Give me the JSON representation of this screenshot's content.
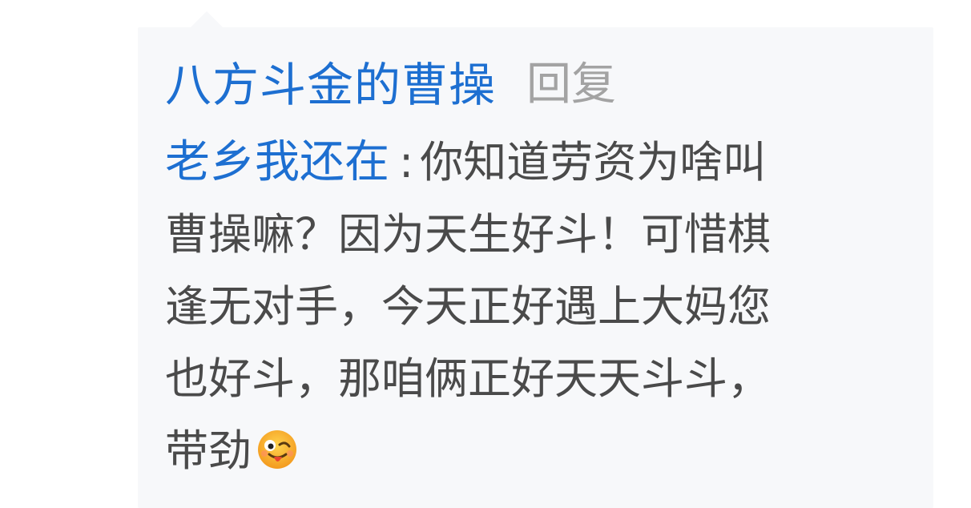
{
  "reply": {
    "author": "八方斗金的曹操",
    "reply_label": "回复",
    "quoted_author": "老乡我还在",
    "separator": ":",
    "lines": [
      "你知道劳资为啥叫",
      "曹操嘛？因为天生好斗！可惜棋",
      "逢无对手，今天正好遇上大妈您",
      "也好斗，那咱俩正好天天斗斗，",
      "带劲"
    ],
    "emoji": "wink-tongue-emoji-icon"
  },
  "colors": {
    "link": "#1d6fd1",
    "text": "#4a4a4a",
    "muted": "#a3a3a3",
    "card_bg": "#f7f8fa"
  }
}
